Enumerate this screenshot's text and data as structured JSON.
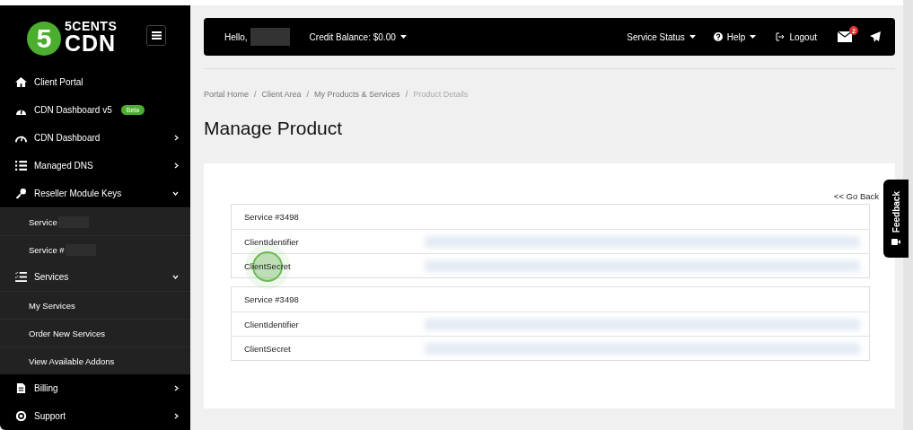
{
  "sidebar": {
    "logo": {
      "digit": "5",
      "brand_top": "5CENTS",
      "brand_bottom": "CDN"
    },
    "items": [
      {
        "label": "Client Portal",
        "selected": false
      },
      {
        "label": "CDN Dashboard v5",
        "badge": "Beta",
        "selected": false
      },
      {
        "label": "CDN Dashboard",
        "expanded": false,
        "selected": false
      },
      {
        "label": "Managed DNS",
        "expanded": false,
        "selected": false
      },
      {
        "label": "Reseller Module Keys",
        "expanded": true,
        "selected": false,
        "children": [
          {
            "label": "Service",
            "redacted": true
          },
          {
            "label": "Service #",
            "redacted": true
          }
        ]
      },
      {
        "label": "Services",
        "expanded": true,
        "selected": true,
        "children": [
          {
            "label": "My Services"
          },
          {
            "label": "Order New Services"
          },
          {
            "label": "View Available Addons"
          }
        ]
      },
      {
        "label": "Billing",
        "expanded": false,
        "selected": false
      },
      {
        "label": "Support",
        "expanded": false,
        "selected": false
      }
    ]
  },
  "topbar": {
    "greeting": "Hello,",
    "name_redacted": true,
    "credit": "Credit Balance: $0.00",
    "service_status": "Service Status",
    "help": "Help",
    "logout": "Logout",
    "mail_badge": "2"
  },
  "breadcrumbs": [
    {
      "label": "Portal Home",
      "current": false
    },
    {
      "label": "Client Area",
      "current": false
    },
    {
      "label": "My Products & Services",
      "current": false
    },
    {
      "label": "Product Details",
      "current": true
    }
  ],
  "breadcrumb_separators": [
    "/",
    "/",
    "/"
  ],
  "page_title": "Manage Product",
  "go_back": "<< Go Back",
  "panels": [
    {
      "rows": [
        {
          "label": "Service #3498"
        },
        {
          "label": "ClientIdentifier",
          "redacted": true
        },
        {
          "label": "ClientSecret",
          "redacted": true,
          "clicked": true
        }
      ]
    },
    {
      "rows": [
        {
          "label": "Service #3498"
        },
        {
          "label": "ClientIdentifier",
          "redacted": true
        },
        {
          "label": "ClientSecret",
          "redacted": true
        }
      ]
    }
  ],
  "feedback": {
    "label": "Feedback"
  }
}
